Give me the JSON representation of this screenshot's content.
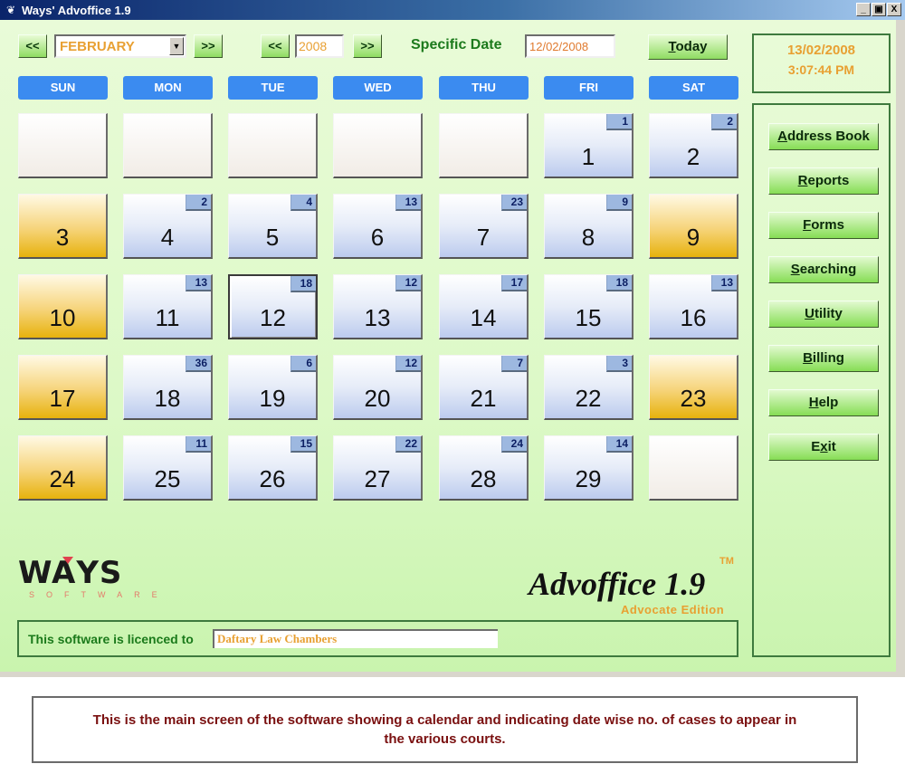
{
  "window": {
    "title": "Ways' Advoffice 1.9",
    "app_icon": "app-logo-icon",
    "controls": {
      "minimize": "_",
      "restore": "▣",
      "close": "X"
    }
  },
  "toolbar": {
    "prev_month_label": "<<",
    "next_month_label": ">>",
    "month_value": "FEBRUARY",
    "prev_year_label": "<<",
    "next_year_label": ">>",
    "year_value": "2008",
    "specific_date_label": "Specific Date",
    "specific_date_value": "12/02/2008",
    "today_label_accel": "T",
    "today_label_rest": "oday"
  },
  "clock": {
    "date": "13/02/2008",
    "time": "3:07:44 PM"
  },
  "weekdays": [
    "SUN",
    "MON",
    "TUE",
    "WED",
    "THU",
    "FRI",
    "SAT"
  ],
  "calendar": {
    "month": "February",
    "year": 2008,
    "selected_day": 12,
    "weeks": [
      [
        null,
        null,
        null,
        null,
        null,
        {
          "day": 1,
          "cases": 1
        },
        {
          "day": 2,
          "cases": 2
        }
      ],
      [
        {
          "day": 3,
          "weekend": true
        },
        {
          "day": 4,
          "cases": 2
        },
        {
          "day": 5,
          "cases": 4
        },
        {
          "day": 6,
          "cases": 13
        },
        {
          "day": 7,
          "cases": 23
        },
        {
          "day": 8,
          "cases": 9
        },
        {
          "day": 9,
          "weekend": true
        }
      ],
      [
        {
          "day": 10,
          "weekend": true
        },
        {
          "day": 11,
          "cases": 13
        },
        {
          "day": 12,
          "cases": 18
        },
        {
          "day": 13,
          "cases": 12
        },
        {
          "day": 14,
          "cases": 17
        },
        {
          "day": 15,
          "cases": 18
        },
        {
          "day": 16,
          "cases": 13
        }
      ],
      [
        {
          "day": 17,
          "weekend": true
        },
        {
          "day": 18,
          "cases": 36
        },
        {
          "day": 19,
          "cases": 6
        },
        {
          "day": 20,
          "cases": 12
        },
        {
          "day": 21,
          "cases": 7
        },
        {
          "day": 22,
          "cases": 3
        },
        {
          "day": 23,
          "weekend": true
        }
      ],
      [
        {
          "day": 24,
          "weekend": true
        },
        {
          "day": 25,
          "cases": 11
        },
        {
          "day": 26,
          "cases": 15
        },
        {
          "day": 27,
          "cases": 22
        },
        {
          "day": 28,
          "cases": 24
        },
        {
          "day": 29,
          "cases": 14
        },
        null
      ]
    ]
  },
  "sidebar": {
    "items": [
      {
        "name": "address-book",
        "accel": "A",
        "rest": "ddress Book"
      },
      {
        "name": "reports",
        "accel": "R",
        "rest": "eports"
      },
      {
        "name": "forms",
        "accel": "F",
        "rest": "orms"
      },
      {
        "name": "searching",
        "accel": "S",
        "rest": "earching"
      },
      {
        "name": "utility",
        "accel": "U",
        "rest": "tility"
      },
      {
        "name": "billing",
        "accel": "B",
        "rest": "illing"
      },
      {
        "name": "help",
        "accel": "H",
        "rest": "elp"
      },
      {
        "name": "exit",
        "pre": "E",
        "accel": "x",
        "rest": "it"
      }
    ]
  },
  "branding": {
    "company_word_1": "W",
    "company_word_2": "A",
    "company_word_3": "YS",
    "company_sub": "SOFTWARE",
    "product": "Advoffice 1.9",
    "trademark": "TM",
    "edition": "Advocate Edition"
  },
  "licence": {
    "label": "This software is licenced to",
    "value": "Daftary Law Chambers"
  },
  "caption": {
    "text": "This is the main screen of the software showing a calendar and indicating date wise no. of cases to appear in the various courts."
  },
  "colors": {
    "weekday_header": "#3b8bf0",
    "weekend_cell": "#e7b20d",
    "badge": "#9db8e0",
    "accent_orange": "#e8a032",
    "label_green": "#1c7a1c",
    "caption_red": "#7a1010"
  }
}
